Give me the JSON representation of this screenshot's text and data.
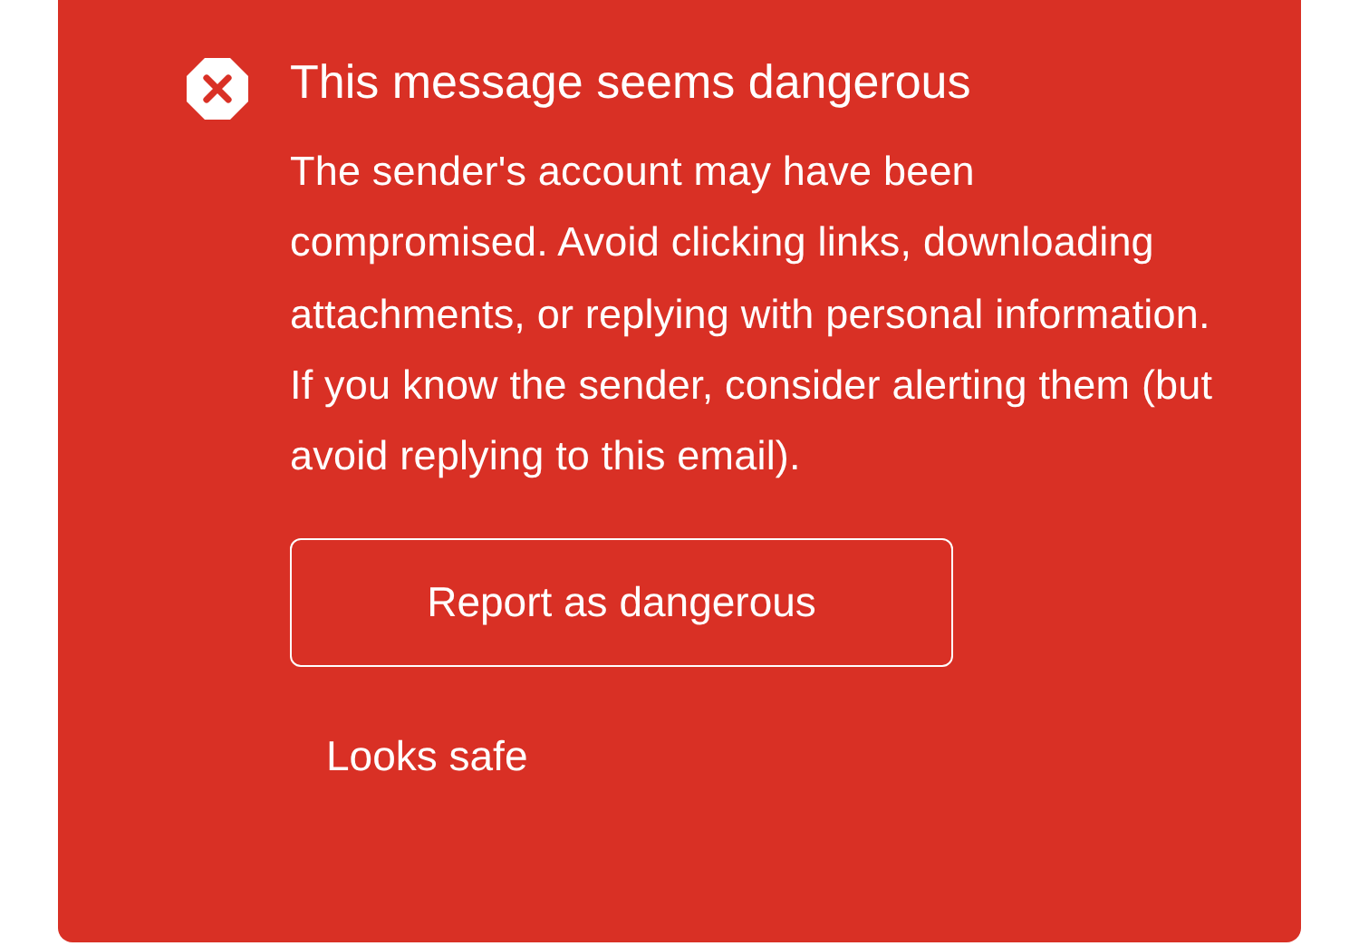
{
  "alert": {
    "title": "This message seems dangerous",
    "body": "The sender's account may have been compromised. Avoid clicking links, downloading attachments, or replying with personal information. If you know the sender, consider alerting them (but avoid replying to this email).",
    "buttons": [
      {
        "label": "Report as dangerous",
        "kind": "outlined"
      },
      {
        "label": "Looks safe",
        "kind": "text"
      }
    ]
  }
}
